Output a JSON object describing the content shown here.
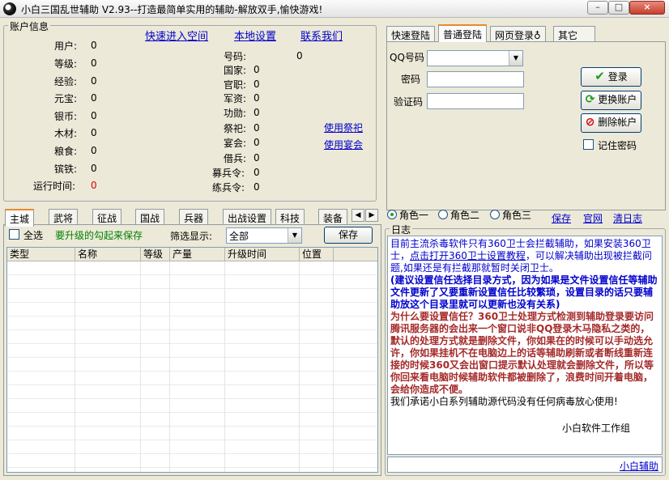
{
  "window": {
    "title": "小白三国乱世辅助 V2.93--打造最简单实用的辅助-解放双手,愉快游戏!",
    "min": "–",
    "max": "□",
    "close": "×"
  },
  "account": {
    "group_title": "账户信息",
    "links": {
      "space": "快速进入空间",
      "settings": "本地设置",
      "contact": "联系我们"
    },
    "left_fields": [
      {
        "label": "用户:",
        "value": "0"
      },
      {
        "label": "等级:",
        "value": "0"
      },
      {
        "label": "经验:",
        "value": "0"
      },
      {
        "label": "元宝:",
        "value": "0"
      },
      {
        "label": "银币:",
        "value": "0"
      },
      {
        "label": "木材:",
        "value": "0"
      },
      {
        "label": "粮食:",
        "value": "0"
      },
      {
        "label": "镔铁:",
        "value": "0"
      },
      {
        "label": "运行时间:",
        "value": "0"
      }
    ],
    "right_fields": [
      {
        "label": "号码:",
        "value": "0"
      },
      {
        "label": "国家:",
        "value": "0"
      },
      {
        "label": "官职:",
        "value": "0"
      },
      {
        "label": "军资:",
        "value": "0"
      },
      {
        "label": "功勋:",
        "value": "0"
      },
      {
        "label": "祭祀:",
        "value": "0"
      },
      {
        "label": "宴会:",
        "value": "0"
      },
      {
        "label": "借兵:",
        "value": "0"
      },
      {
        "label": "募兵令:",
        "value": "0"
      },
      {
        "label": "练兵令:",
        "value": "0"
      }
    ],
    "use_sacrifice": "使用祭祀",
    "use_banquet": "使用宴会"
  },
  "login": {
    "tabs": [
      "快速登陆",
      "普通登陆",
      "网页登录♁",
      "其它"
    ],
    "active_tab": 1,
    "qq_label": "QQ号码",
    "pwd_label": "密码",
    "code_label": "验证码",
    "qq_value": "",
    "pwd_value": "",
    "code_value": "",
    "login_btn": "登录",
    "switch_btn": "更换账户",
    "delete_btn": "删除帐户",
    "remember": "记住密码"
  },
  "main_tabs": {
    "tabs": [
      "主城",
      "武将",
      "征战",
      "国战",
      "兵器",
      "出战设置",
      "科技",
      "装备"
    ],
    "active_tab": 0,
    "select_all": "全选",
    "upgrade_hint": "要升级的勾起来保存",
    "filter_label": "筛选显示:",
    "filter_value": "全部",
    "save_btn": "保存",
    "columns": [
      "类型",
      "名称",
      "等级",
      "产量",
      "升级时间",
      "位置"
    ],
    "scroll_left": "◀",
    "scroll_right": "▶"
  },
  "roles": {
    "options": [
      "角色一",
      "角色二",
      "角色三"
    ],
    "selected": 0,
    "save": "保存",
    "site": "官网",
    "clear": "清日志"
  },
  "log": {
    "title": "日志",
    "p1": "目前主流杀毒软件只有360卫士会拦截辅助，如果安装360卫士，",
    "p1_link": "点击打开360卫士设置教程",
    "p1_rest": "，可以解决辅助出现被拦截问题,如果还是有拦截那就暂时关闭卫士。",
    "p2": "(建议设置信任选择目录方式，因为如果是文件设置信任等辅助文件更新了又要重新设置信任比较繁琐，设置目录的话只要辅助放这个目录里就可以更新也没有关系)",
    "p3": "为什么要设置信任？360卫士处理方式检测到辅助登录要访问腾讯服务器的会出来一个窗口说非QQ登录木马隐私之类的，默认的处理方式就是删除文件，你如果在的时候可以手动选允许，你如果挂机不在电脑边上的话等辅助刷新或者断线重新连接的时候360又会出窗口提示默认处理就会删除文件，所以等你回来看电脑时候辅助软件都被删除了，浪费时间开着电脑，会给你造成不便。",
    "p4": "我们承诺小白系列辅助源代码没有任何病毒放心使用!",
    "signature": "小白软件工作组",
    "footer_link": "小白辅助"
  },
  "colors": {
    "background": "#ece9d8",
    "link": "#0000cc",
    "accent_tab": "#e68b2c",
    "log_brown": "#a52a2a"
  }
}
